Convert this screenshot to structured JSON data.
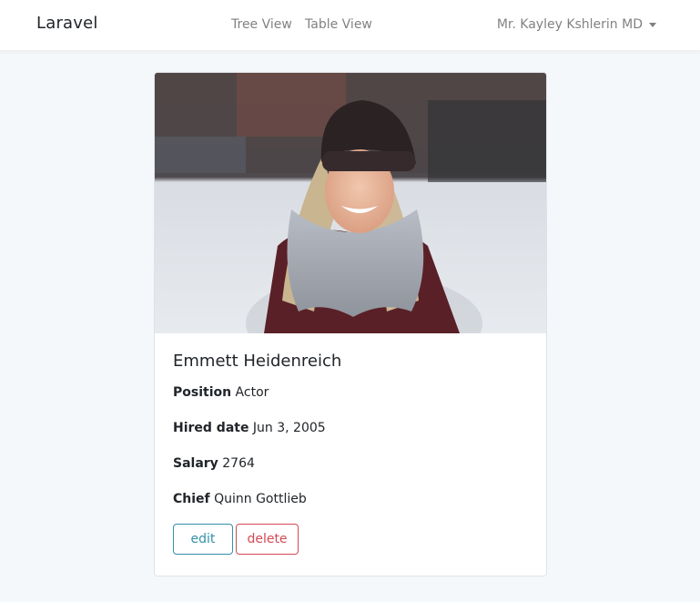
{
  "navbar": {
    "brand": "Laravel",
    "links": [
      {
        "label": "Tree View"
      },
      {
        "label": "Table View"
      }
    ],
    "user": "Mr. Kayley Kshlerin MD"
  },
  "employee": {
    "name": "Emmett Heidenreich",
    "fields": [
      {
        "label": "Position",
        "value": "Actor"
      },
      {
        "label": "Hired date",
        "value": "Jun 3, 2005"
      },
      {
        "label": "Salary",
        "value": "2764"
      },
      {
        "label": "Chief",
        "value": "Quinn Gottlieb"
      }
    ],
    "actions": {
      "edit": "edit",
      "delete": "delete"
    }
  },
  "colors": {
    "edit": "#3490a8",
    "delete": "#d34a55",
    "background": "#f5f8fa"
  }
}
